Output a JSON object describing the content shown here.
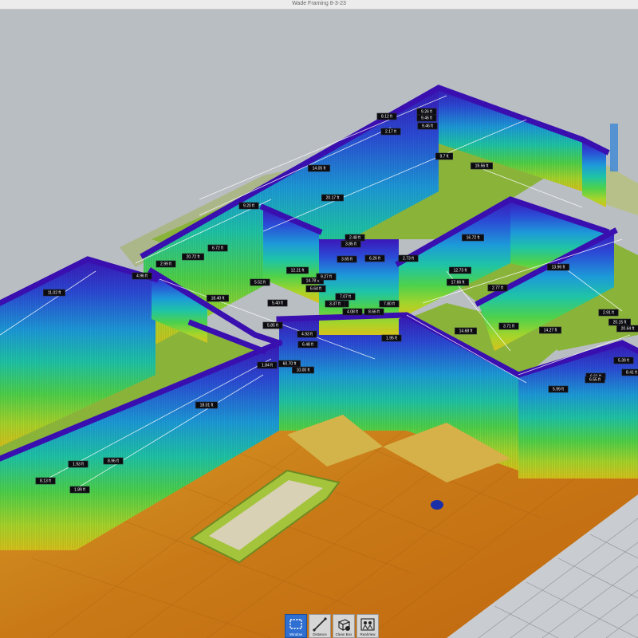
{
  "window": {
    "title": "Wade Framing 8-3-23"
  },
  "measurements": [
    "9.26 ft",
    "8.12 ft",
    "9.46 ft",
    "2.17 ft",
    "9.46 ft",
    "9.7 ft",
    "19.56 ft",
    "14.05 ft",
    "20.17 ft",
    "9.20 ft",
    "2.99 ft",
    "20.72 ft",
    "6.72 ft",
    "4.96 ft",
    "11.02 ft",
    "2.48 ft",
    "3.85 ft",
    "6.26 ft",
    "2.73 ft",
    "16.72 ft",
    "12.21 ft",
    "3.65 ft",
    "12.73 ft",
    "14.78 ft",
    "9.27 ft",
    "5.52 ft",
    "6.64 ft",
    "4.37 ft",
    "17.66 ft",
    "18.40 ft",
    "5.40 ft",
    "3.37 ft",
    "7.07 ft",
    "4.08 ft",
    "7.80 ft",
    "13.96 ft",
    "5.85 ft",
    "8.66 ft",
    "2.77 ft",
    "14.68 ft",
    "3.71 ft",
    "14.27 ft",
    "2.91 ft",
    "20.15 ft",
    "20.64 ft",
    "4.93 ft",
    "1.95 ft",
    "6.48 ft",
    "1.84 ft",
    "60.70 ft",
    "10.00 ft",
    "5.39 ft",
    "6.61 ft",
    "6.55 ft",
    "8.41 ft",
    "5.99 ft",
    "18.01 ft",
    "1.93 ft",
    "8.96 ft",
    "8.13 ft",
    "1.89 ft"
  ],
  "toolbar": {
    "tools": [
      {
        "label": "Window",
        "icon": "selection-window-icon",
        "active": true
      },
      {
        "label": "Distance",
        "icon": "ruler-distance-icon",
        "active": false
      },
      {
        "label": "Clean Box",
        "icon": "clean-box-icon",
        "active": false
      },
      {
        "label": "RealView",
        "icon": "realview-icon",
        "active": false
      }
    ]
  }
}
